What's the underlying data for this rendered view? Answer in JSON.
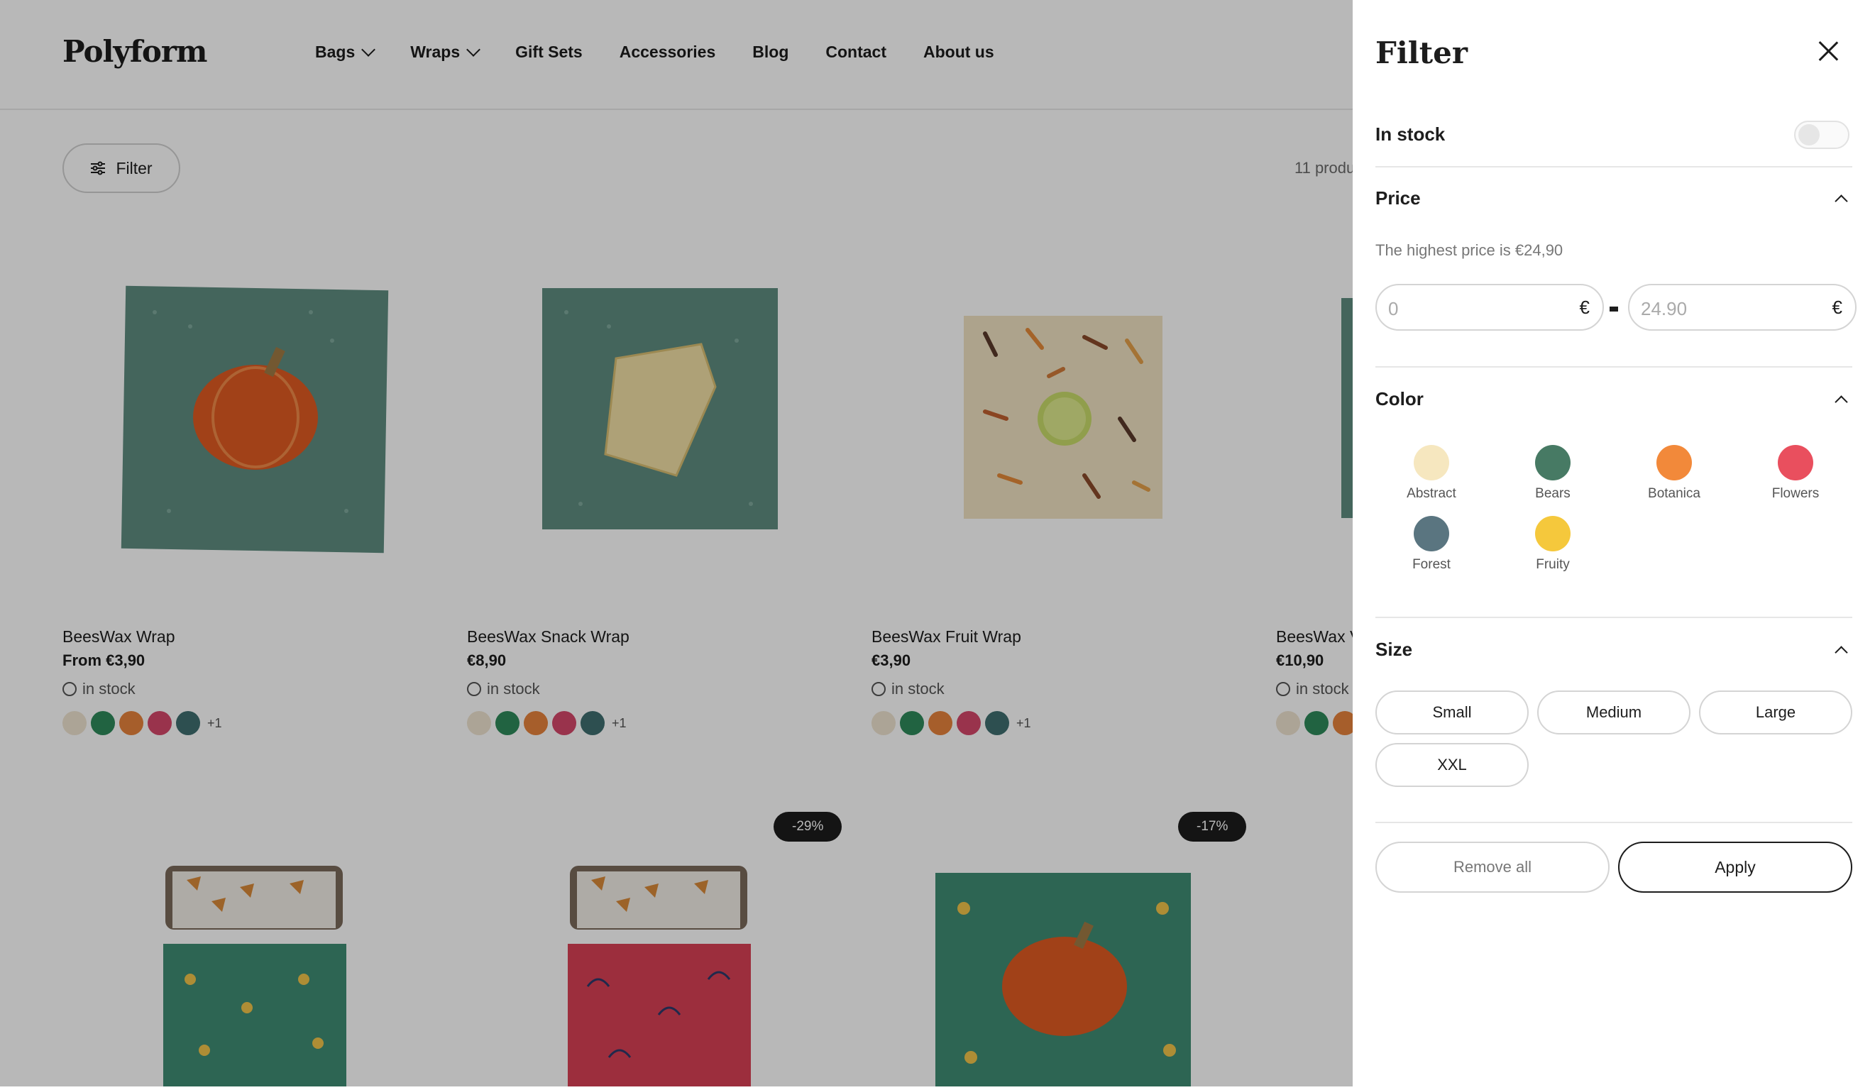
{
  "brand": "Polyform",
  "nav": [
    {
      "label": "Bags",
      "has_dropdown": true
    },
    {
      "label": "Wraps",
      "has_dropdown": true
    },
    {
      "label": "Gift Sets",
      "has_dropdown": false
    },
    {
      "label": "Accessories",
      "has_dropdown": false
    },
    {
      "label": "Blog",
      "has_dropdown": false
    },
    {
      "label": "Contact",
      "has_dropdown": false
    },
    {
      "label": "About us",
      "has_dropdown": false
    }
  ],
  "toolbar": {
    "filter_label": "Filter",
    "count_text": "11 produ"
  },
  "products": [
    {
      "title": "BeesWax Wrap",
      "price": "From €3,90",
      "stock": "in stock",
      "more": "+1"
    },
    {
      "title": "BeesWax Snack Wrap",
      "price": "€8,90",
      "stock": "in stock",
      "more": "+1"
    },
    {
      "title": "BeesWax Fruit Wrap",
      "price": "€3,90",
      "stock": "in stock",
      "more": "+1"
    },
    {
      "title": "BeesWax V",
      "price": "€10,90",
      "stock": "in stock"
    }
  ],
  "badges": [
    "-29%",
    "-17%"
  ],
  "swatch_colors": [
    "#efe3d0",
    "#2f8a5a",
    "#e7833c",
    "#d4476a",
    "#3f6e6f"
  ],
  "filter": {
    "title": "Filter",
    "in_stock": {
      "label": "In stock",
      "enabled": false
    },
    "price": {
      "label": "Price",
      "hint": "The highest price is €24,90",
      "min_placeholder": "0",
      "max_placeholder": "24.90",
      "currency": "€"
    },
    "color": {
      "label": "Color",
      "options": [
        {
          "name": "Abstract",
          "hex": "#f6e7bf"
        },
        {
          "name": "Bears",
          "hex": "#477a64"
        },
        {
          "name": "Botanica",
          "hex": "#f2893a"
        },
        {
          "name": "Flowers",
          "hex": "#e94f5e"
        },
        {
          "name": "Forest",
          "hex": "#5a7580"
        },
        {
          "name": "Fruity",
          "hex": "#f5c83c"
        }
      ]
    },
    "size": {
      "label": "Size",
      "options": [
        "Small",
        "Medium",
        "Large",
        "XXL"
      ]
    },
    "remove_label": "Remove all",
    "apply_label": "Apply"
  }
}
